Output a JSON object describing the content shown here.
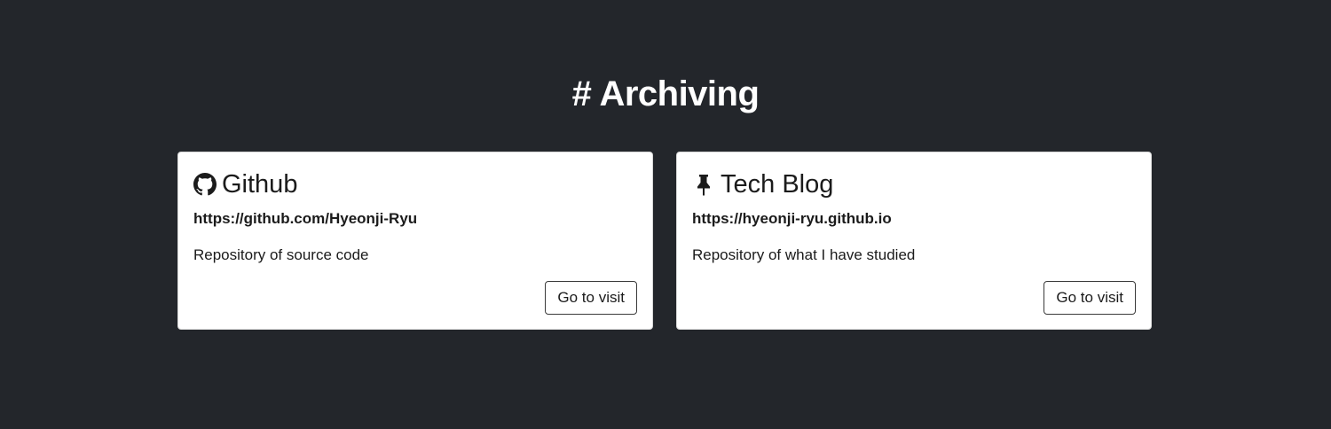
{
  "section": {
    "title": "# Archiving"
  },
  "cards": [
    {
      "icon": "github-icon",
      "title": "Github",
      "url": "https://github.com/Hyeonji-Ryu",
      "description": "Repository of source code",
      "button_label": "Go to visit"
    },
    {
      "icon": "pushpin-icon",
      "title": "Tech Blog",
      "url": "https://hyeonji-ryu.github.io",
      "description": "Repository of what I have studied",
      "button_label": "Go to visit"
    }
  ],
  "colors": {
    "background": "#23262b",
    "card_background": "#ffffff",
    "text": "#1b1b1b",
    "title_text": "#ffffff"
  }
}
